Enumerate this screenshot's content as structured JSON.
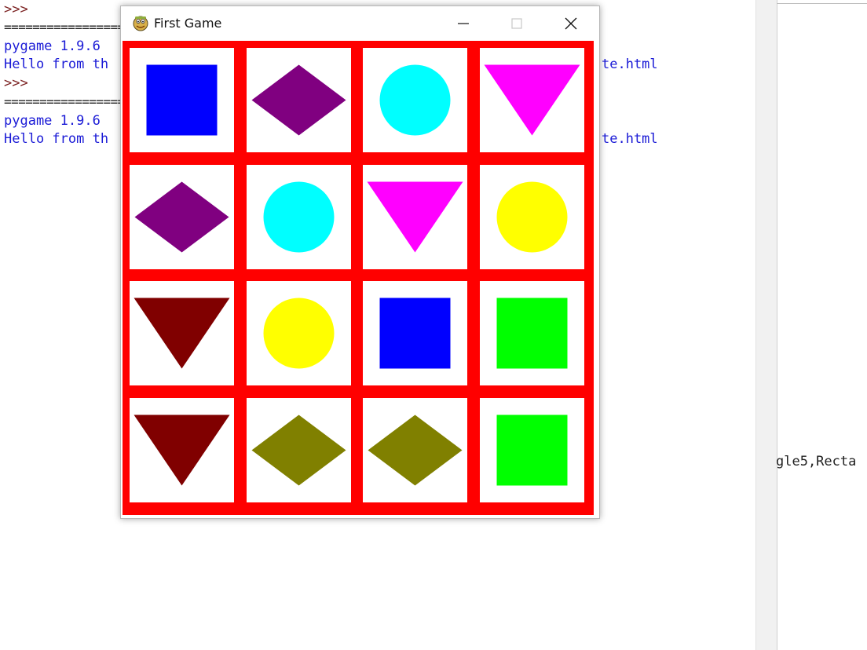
{
  "shell": {
    "lines": [
      {
        "text": ">>>",
        "kind": "prompt"
      },
      {
        "text": "===============================================================================",
        "kind": "sep"
      },
      {
        "text": "pygame 1.9.6",
        "kind": "out"
      },
      {
        "text": "Hello from th",
        "kind": "out"
      },
      {
        "text": ">>>",
        "kind": "prompt"
      },
      {
        "text": "===============================================================================",
        "kind": "sep"
      },
      {
        "text": "pygame 1.9.6",
        "kind": "out"
      },
      {
        "text": "Hello from th",
        "kind": "out"
      }
    ],
    "right_fragments": {
      "line1": "te.html",
      "line2": "te.html"
    },
    "right_panel_text": "gle5,Recta"
  },
  "window": {
    "title": "First Game",
    "icon": "pygame-snake-icon",
    "buttons": [
      "minimize-icon",
      "maximize-icon",
      "close-icon"
    ]
  },
  "board": {
    "grid_color": "#ff0000",
    "cell_color": "#ffffff",
    "rows": [
      [
        {
          "shape": "square",
          "color": "#0000ff"
        },
        {
          "shape": "diamond",
          "color": "#800080"
        },
        {
          "shape": "circle",
          "color": "#00ffff"
        },
        {
          "shape": "triangle",
          "color": "#ff00ff"
        }
      ],
      [
        {
          "shape": "diamond",
          "color": "#800080"
        },
        {
          "shape": "circle",
          "color": "#00ffff"
        },
        {
          "shape": "triangle",
          "color": "#ff00ff"
        },
        {
          "shape": "circle",
          "color": "#ffff00"
        }
      ],
      [
        {
          "shape": "triangle",
          "color": "#800000"
        },
        {
          "shape": "circle",
          "color": "#ffff00"
        },
        {
          "shape": "square",
          "color": "#0000ff"
        },
        {
          "shape": "square",
          "color": "#00ff00"
        }
      ],
      [
        {
          "shape": "triangle",
          "color": "#800000"
        },
        {
          "shape": "diamond",
          "color": "#808000"
        },
        {
          "shape": "diamond",
          "color": "#808000"
        },
        {
          "shape": "square",
          "color": "#00ff00"
        }
      ]
    ]
  }
}
